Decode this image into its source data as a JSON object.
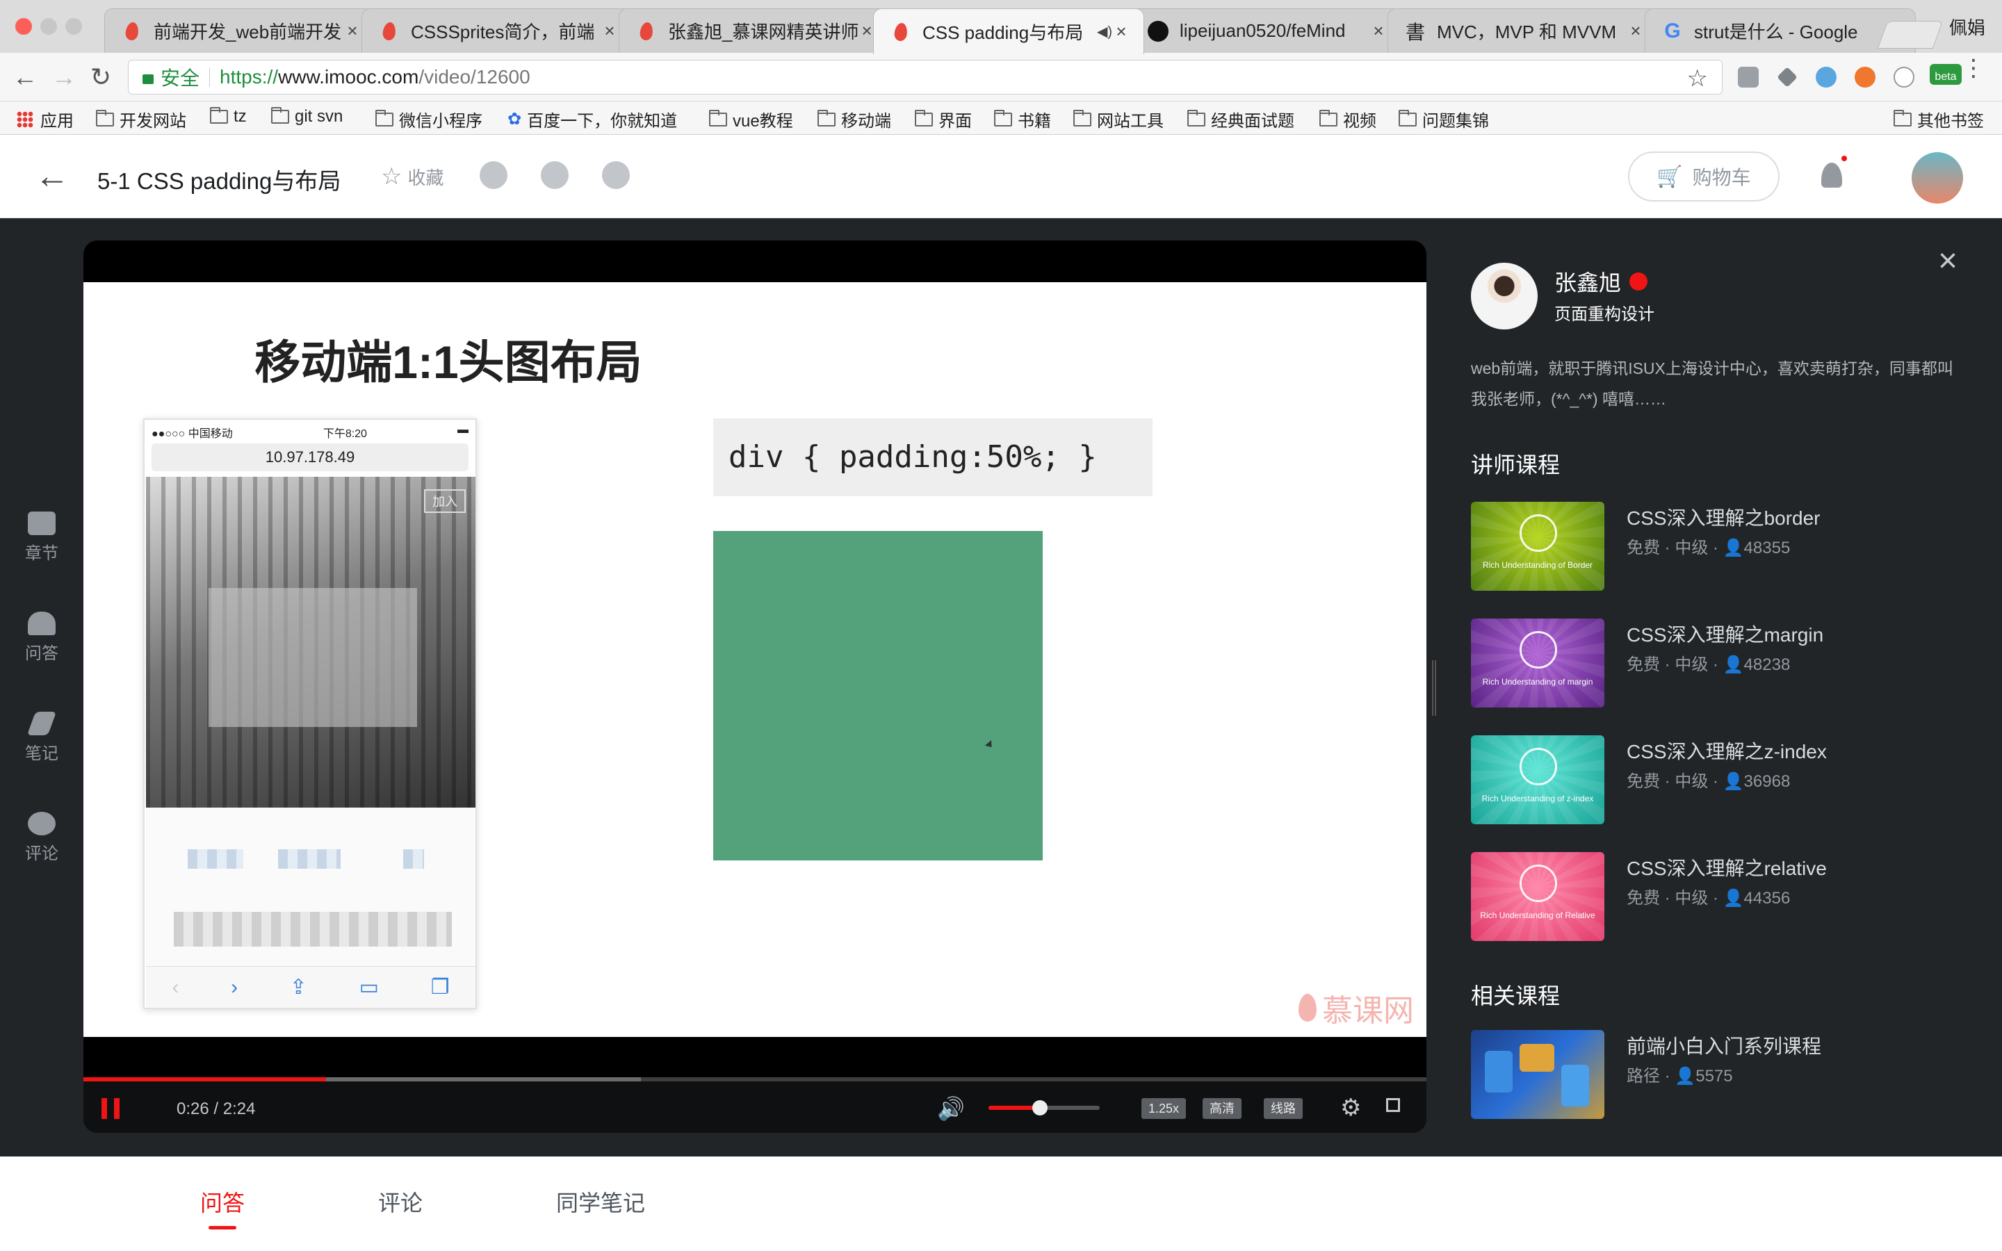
{
  "browser": {
    "tabs": [
      {
        "title": "前端开发_web前端开发",
        "icon": "imooc-flame-icon"
      },
      {
        "title": "CSSSprites简介，前端",
        "icon": "imooc-flame-icon"
      },
      {
        "title": "张鑫旭_慕课网精英讲师",
        "icon": "imooc-flame-icon"
      },
      {
        "title": "CSS padding与布局",
        "icon": "imooc-flame-icon",
        "active": true
      },
      {
        "title": "lipeijuan0520/feMind",
        "icon": "github-icon"
      },
      {
        "title": "MVC，MVP 和 MVVM",
        "icon": "site-icon"
      },
      {
        "title": "strut是什么 - Google",
        "icon": "google-icon"
      }
    ],
    "profile_name": "佩娟",
    "secure_label": "安全",
    "url": {
      "proto": "https://",
      "host": "www.imooc.com",
      "path": "/video/12600"
    },
    "beta_label": "beta",
    "bookmarks": [
      "应用",
      "开发网站",
      "tz",
      "git svn",
      "微信小程序",
      "百度一下，你就知道",
      "vue教程",
      "移动端",
      "界面",
      "书籍",
      "网站工具",
      "经典面试题",
      "视频",
      "问题集锦"
    ],
    "other_bookmarks": "其他书签"
  },
  "header": {
    "title": "5-1 CSS padding与布局",
    "collect": "收藏",
    "cart": "购物车"
  },
  "leftnav": [
    "章节",
    "问答",
    "笔记",
    "评论"
  ],
  "slide": {
    "title": "移动端1:1头图布局",
    "code": "div { padding:50%; }",
    "phone_carrier": "●●○○○ 中国移动",
    "phone_time": "下午8:20",
    "phone_url": "10.97.178.49",
    "phone_join": "加入",
    "watermark": "慕课网"
  },
  "player": {
    "time": "0:26 / 2:24",
    "progress_fraction": 0.1806,
    "buffered_fraction": 0.415,
    "volume_fraction": 0.46,
    "speed": "1.25x",
    "quality": "高清",
    "route": "线路"
  },
  "teacher": {
    "name": "张鑫旭",
    "role": "页面重构设计",
    "bio": "web前端，就职于腾讯ISUX上海设计中心，喜欢卖萌打杂，同事都叫我张老师，(*^_^*) 嘻嘻……"
  },
  "teacher_courses_title": "讲师课程",
  "teacher_courses": [
    {
      "title": "CSS深入理解之border",
      "meta": "免费 · 中级 · ",
      "count": "48355",
      "thumb_caption": "Rich Understanding of Border",
      "color_a": "#b6d61e",
      "color_b": "#4f7d12"
    },
    {
      "title": "CSS深入理解之margin",
      "meta": "免费 · 中级 · ",
      "count": "48238",
      "thumb_caption": "Rich Understanding of margin",
      "color_a": "#b164d6",
      "color_b": "#5a2386"
    },
    {
      "title": "CSS深入理解之z-index",
      "meta": "免费 · 中级 · ",
      "count": "36968",
      "thumb_caption": "Rich Understanding of z-index",
      "color_a": "#5fe6d6",
      "color_b": "#1aa397"
    },
    {
      "title": "CSS深入理解之relative",
      "meta": "免费 · 中级 · ",
      "count": "44356",
      "thumb_caption": "Rich Understanding of Relative",
      "color_a": "#ff86a8",
      "color_b": "#e23b6b"
    }
  ],
  "related_title": "相关课程",
  "related_courses": [
    {
      "title": "前端小白入门系列课程",
      "meta": "路径 · ",
      "count": "5575"
    }
  ],
  "bottom_tabs": [
    "问答",
    "评论",
    "同学笔记"
  ],
  "colors": {
    "accent": "#f01414",
    "slide_green": "#53a27b",
    "dark_bg": "#212528"
  }
}
